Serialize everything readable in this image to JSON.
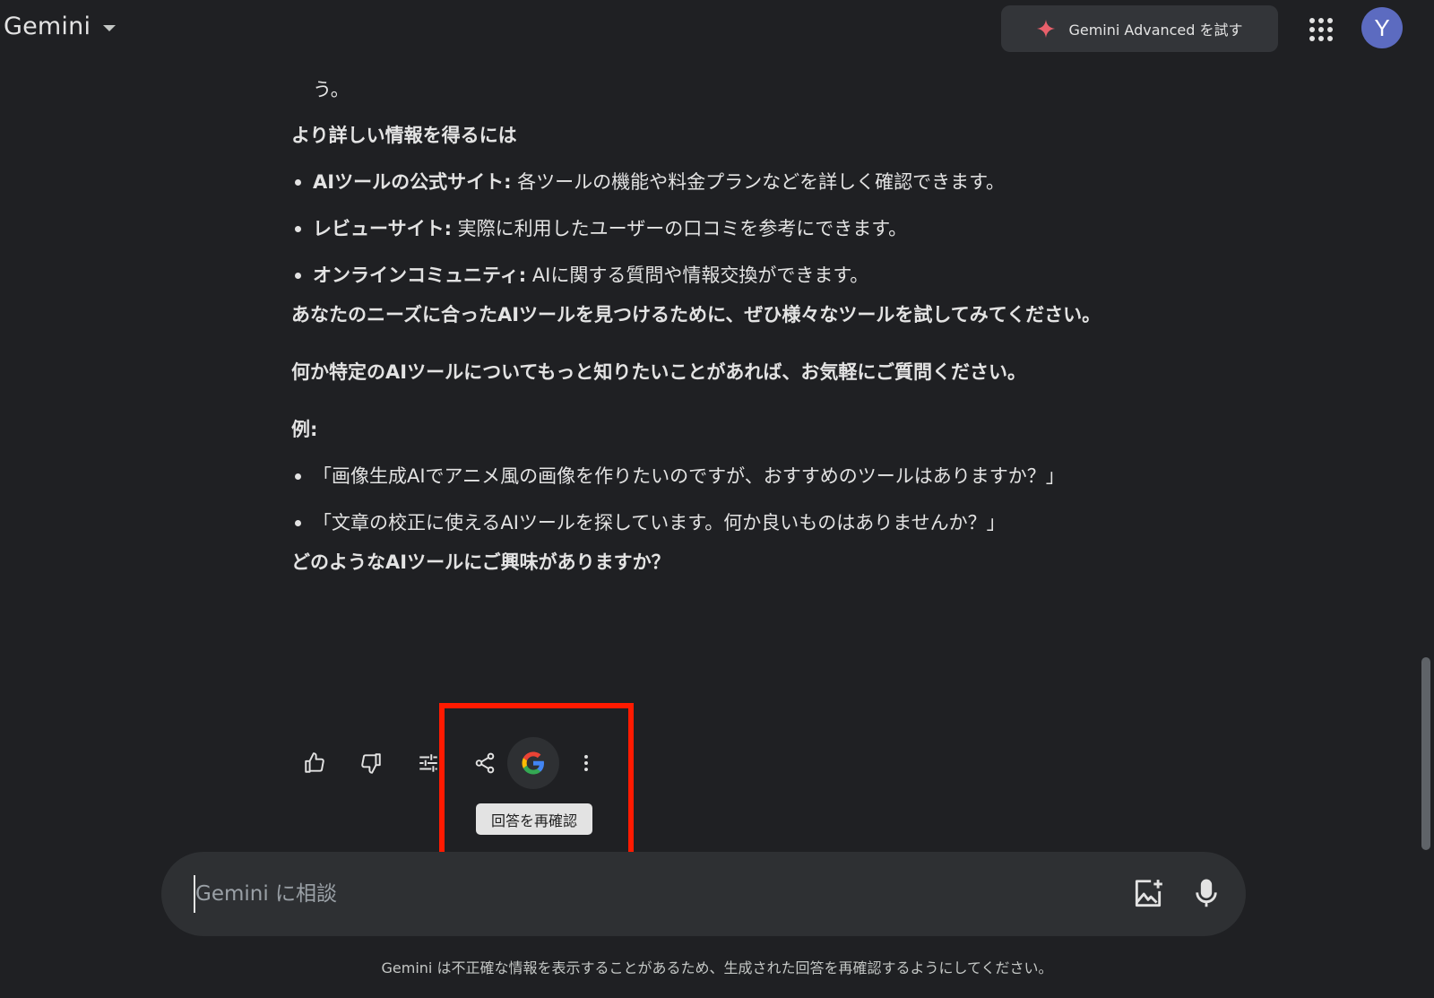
{
  "header": {
    "brand": "Gemini",
    "advanced_button": "Gemini Advanced を試す",
    "avatar_initial": "Y"
  },
  "content": {
    "first_line": "う。",
    "heading_more_info": "より詳しい情報を得るには",
    "info_items": [
      {
        "title": "AIツールの公式サイト:",
        "text": " 各ツールの機能や料金プランなどを詳しく確認できます。"
      },
      {
        "title": "レビューサイト:",
        "text": " 実際に利用したユーザーの口コミを参考にできます。"
      },
      {
        "title": "オンラインコミュニティ:",
        "text": " AIに関する質問や情報交換ができます。"
      }
    ],
    "encourage": "あなたのニーズに合ったAIツールを見つけるために、ぜひ様々なツールを試してみてください。",
    "ask_more": "何か特定のAIツールについてもっと知りたいことがあれば、お気軽にご質問ください。",
    "example_label": "例:",
    "examples": [
      "「画像生成AIでアニメ風の画像を作りたいのですが、おすすめのツールはありますか？」",
      "「文章の校正に使えるAIツールを探しています。何か良いものはありませんか？」"
    ],
    "closing_question": "どのようなAIツールにご興味がありますか？"
  },
  "actions": {
    "tooltip": "回答を再確認"
  },
  "input": {
    "placeholder": "Gemini に相談"
  },
  "disclaimer": "Gemini は不正確な情報を表示することがあるため、生成された回答を再確認するようにしてください。",
  "icons": [
    "caret-down-icon",
    "sparkle-icon",
    "apps-grid-icon",
    "thumbs-up-icon",
    "thumbs-down-icon",
    "tune-icon",
    "share-icon",
    "google-g-icon",
    "more-vert-icon",
    "add-image-icon",
    "mic-icon"
  ],
  "colors": {
    "background": "#1f2023",
    "highlight": "#ff1a00",
    "avatar": "#5c6bc0",
    "sparkle": "#e8606b"
  }
}
